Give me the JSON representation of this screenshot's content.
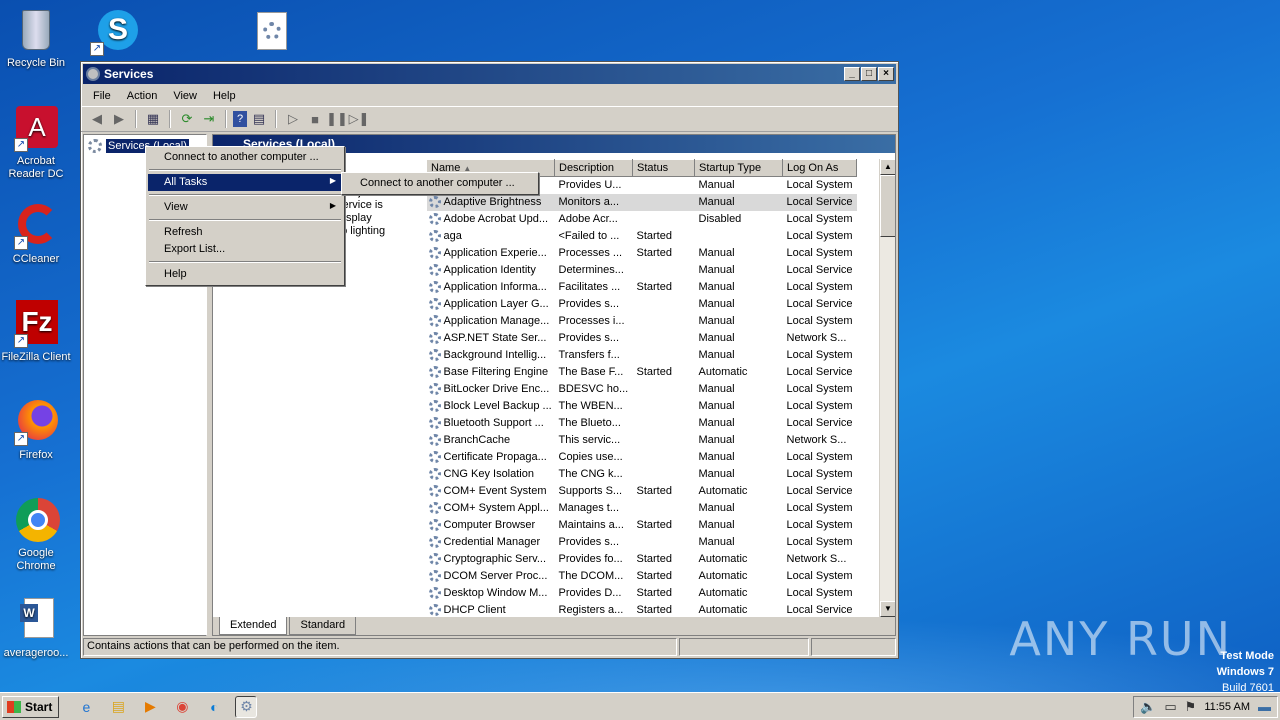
{
  "desktop": {
    "icons": [
      {
        "label": "Recycle Bin"
      },
      {
        "label": "Acrobat Reader DC"
      },
      {
        "label": "CCleaner"
      },
      {
        "label": "FileZilla Client"
      },
      {
        "label": "Firefox"
      },
      {
        "label": "Google Chrome"
      },
      {
        "label": "averageroo..."
      }
    ],
    "watermark": "ANY RUN",
    "test_mode": {
      "line1": "Test Mode",
      "line2": "Windows 7",
      "line3": "Build 7601"
    }
  },
  "window": {
    "title": "Services",
    "menu": [
      "File",
      "Action",
      "View",
      "Help"
    ],
    "tree_root": "Services (Local)",
    "right_header": "Services (Local)",
    "description": "...ors to detect ...d adjust the ...service is stopped or disabled, the display brightness will not adapt to lighting conditions.",
    "columns": [
      "Name",
      "Description",
      "Status",
      "Startup Type",
      "Log On As"
    ],
    "rows": [
      {
        "name": "",
        "desc": "Provides U...",
        "status": "",
        "startup": "Manual",
        "logon": "Local System"
      },
      {
        "name": "Adaptive Brightness",
        "desc": "Monitors a...",
        "status": "",
        "startup": "Manual",
        "logon": "Local Service"
      },
      {
        "name": "Adobe Acrobat Upd...",
        "desc": "Adobe Acr...",
        "status": "",
        "startup": "Disabled",
        "logon": "Local System"
      },
      {
        "name": "aga",
        "desc": "<Failed to ...",
        "status": "Started",
        "startup": "",
        "logon": "Local System"
      },
      {
        "name": "Application Experie...",
        "desc": "Processes ...",
        "status": "Started",
        "startup": "Manual",
        "logon": "Local System"
      },
      {
        "name": "Application Identity",
        "desc": "Determines...",
        "status": "",
        "startup": "Manual",
        "logon": "Local Service"
      },
      {
        "name": "Application Informa...",
        "desc": "Facilitates ...",
        "status": "Started",
        "startup": "Manual",
        "logon": "Local System"
      },
      {
        "name": "Application Layer G...",
        "desc": "Provides s...",
        "status": "",
        "startup": "Manual",
        "logon": "Local Service"
      },
      {
        "name": "Application Manage...",
        "desc": "Processes i...",
        "status": "",
        "startup": "Manual",
        "logon": "Local System"
      },
      {
        "name": "ASP.NET State Ser...",
        "desc": "Provides s...",
        "status": "",
        "startup": "Manual",
        "logon": "Network S..."
      },
      {
        "name": "Background Intellig...",
        "desc": "Transfers f...",
        "status": "",
        "startup": "Manual",
        "logon": "Local System"
      },
      {
        "name": "Base Filtering Engine",
        "desc": "The Base F...",
        "status": "Started",
        "startup": "Automatic",
        "logon": "Local Service"
      },
      {
        "name": "BitLocker Drive Enc...",
        "desc": "BDESVC ho...",
        "status": "",
        "startup": "Manual",
        "logon": "Local System"
      },
      {
        "name": "Block Level Backup ...",
        "desc": "The WBEN...",
        "status": "",
        "startup": "Manual",
        "logon": "Local System"
      },
      {
        "name": "Bluetooth Support ...",
        "desc": "The Blueto...",
        "status": "",
        "startup": "Manual",
        "logon": "Local Service"
      },
      {
        "name": "BranchCache",
        "desc": "This servic...",
        "status": "",
        "startup": "Manual",
        "logon": "Network S..."
      },
      {
        "name": "Certificate Propaga...",
        "desc": "Copies use...",
        "status": "",
        "startup": "Manual",
        "logon": "Local System"
      },
      {
        "name": "CNG Key Isolation",
        "desc": "The CNG k...",
        "status": "",
        "startup": "Manual",
        "logon": "Local System"
      },
      {
        "name": "COM+ Event System",
        "desc": "Supports S...",
        "status": "Started",
        "startup": "Automatic",
        "logon": "Local Service"
      },
      {
        "name": "COM+ System Appl...",
        "desc": "Manages t...",
        "status": "",
        "startup": "Manual",
        "logon": "Local System"
      },
      {
        "name": "Computer Browser",
        "desc": "Maintains a...",
        "status": "Started",
        "startup": "Manual",
        "logon": "Local System"
      },
      {
        "name": "Credential Manager",
        "desc": "Provides s...",
        "status": "",
        "startup": "Manual",
        "logon": "Local System"
      },
      {
        "name": "Cryptographic Serv...",
        "desc": "Provides fo...",
        "status": "Started",
        "startup": "Automatic",
        "logon": "Network S..."
      },
      {
        "name": "DCOM Server Proc...",
        "desc": "The DCOM...",
        "status": "Started",
        "startup": "Automatic",
        "logon": "Local System"
      },
      {
        "name": "Desktop Window M...",
        "desc": "Provides D...",
        "status": "Started",
        "startup": "Automatic",
        "logon": "Local System"
      },
      {
        "name": "DHCP Client",
        "desc": "Registers a...",
        "status": "Started",
        "startup": "Automatic",
        "logon": "Local Service"
      }
    ],
    "tabs": [
      "Extended",
      "Standard"
    ],
    "status_text": "Contains actions that can be performed on the item."
  },
  "context_menu": {
    "items": [
      "Connect to another computer ...",
      "All Tasks",
      "View",
      "Refresh",
      "Export List...",
      "Help"
    ]
  },
  "submenu": {
    "items": [
      "Connect to another computer ..."
    ]
  },
  "taskbar": {
    "start": "Start",
    "clock": "11:55 AM"
  }
}
